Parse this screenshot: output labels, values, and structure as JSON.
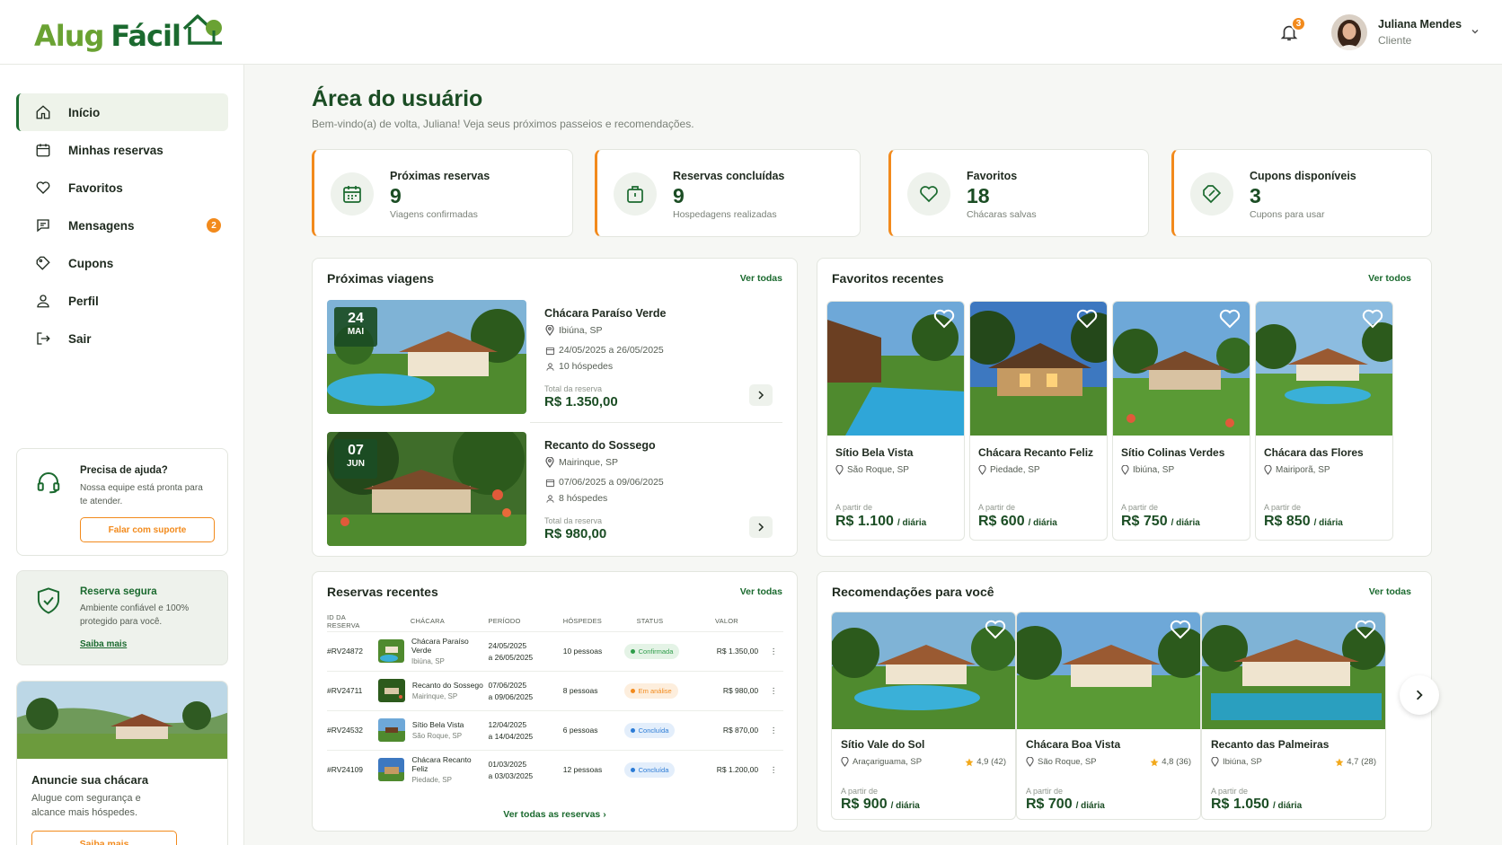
{
  "brand": {
    "part1": "Alug",
    "part2": "Fácil"
  },
  "header": {
    "notifications_count": "3",
    "user_name": "Juliana Mendes",
    "user_role": "Cliente"
  },
  "sidebar": {
    "items": [
      {
        "label": "Início",
        "icon": "home-icon"
      },
      {
        "label": "Minhas reservas",
        "icon": "calendar-icon"
      },
      {
        "label": "Favoritos",
        "icon": "heart-icon"
      },
      {
        "label": "Mensagens",
        "icon": "chat-icon",
        "badge": "2"
      },
      {
        "label": "Cupons",
        "icon": "ticket-icon"
      },
      {
        "label": "Perfil",
        "icon": "user-icon"
      },
      {
        "label": "Sair",
        "icon": "logout-icon"
      }
    ],
    "help": {
      "title": "Precisa de ajuda?",
      "text": "Nossa equipe está pronta para te atender.",
      "button": "Falar com suporte"
    },
    "secure": {
      "title": "Reserva segura",
      "text": "Ambiente confiável e 100% protegido para você.",
      "link": "Saiba mais"
    },
    "promo": {
      "title": "Anuncie sua chácara",
      "text": "Alugue com segurança e alcance mais hóspedes.",
      "button": "Saiba mais"
    }
  },
  "main": {
    "title": "Área do usuário",
    "subtitle": "Bem-vindo(a) de volta, Juliana! Veja seus próximos passeios e recomendações."
  },
  "stats": [
    {
      "label": "Próximas reservas",
      "value": "9",
      "sub": "Viagens confirmadas",
      "icon": "calendar-icon"
    },
    {
      "label": "Reservas concluídas",
      "value": "9",
      "sub": "Hospedagens realizadas",
      "icon": "luggage-icon"
    },
    {
      "label": "Favoritos",
      "value": "18",
      "sub": "Chácaras salvas",
      "icon": "heart-icon"
    },
    {
      "label": "Cupons disponíveis",
      "value": "3",
      "sub": "Cupons para usar",
      "icon": "coupon-icon"
    }
  ],
  "upcoming": {
    "title": "Próximas viagens",
    "link": "Ver todas",
    "trips": [
      {
        "day": "24",
        "month": "MAI",
        "name": "Chácara Paraíso Verde",
        "location": "Ibiúna, SP",
        "dates": "24/05/2025 a 26/05/2025",
        "guests": "10 hóspedes",
        "total_label": "Total da reserva",
        "price": "R$ 1.350,00"
      },
      {
        "day": "07",
        "month": "JUN",
        "name": "Recanto do Sossego",
        "location": "Mairinque, SP",
        "dates": "07/06/2025 a 09/06/2025",
        "guests": "8 hóspedes",
        "total_label": "Total da reserva",
        "price": "R$ 980,00"
      }
    ]
  },
  "favorites": {
    "title": "Favoritos recentes",
    "link": "Ver todos",
    "items": [
      {
        "name": "Sítio Bela Vista",
        "location": "São Roque, SP",
        "from": "A partir de",
        "price": "R$ 1.100",
        "unit": "/ diária"
      },
      {
        "name": "Chácara Recanto Feliz",
        "location": "Piedade, SP",
        "from": "A partir de",
        "price": "R$ 600",
        "unit": "/ diária"
      },
      {
        "name": "Sítio Colinas Verdes",
        "location": "Ibiúna, SP",
        "from": "A partir de",
        "price": "R$ 750",
        "unit": "/ diária"
      },
      {
        "name": "Chácara das Flores",
        "location": "Mairiporã, SP",
        "from": "A partir de",
        "price": "R$ 850",
        "unit": "/ diária"
      }
    ]
  },
  "reservations": {
    "title": "Reservas recentes",
    "link": "Ver todas",
    "footer_link": "Ver todas as reservas",
    "columns": [
      "ID DA RESERVA",
      "CHÁCARA",
      "PERÍODO",
      "HÓSPEDES",
      "STATUS",
      "VALOR"
    ],
    "rows": [
      {
        "id": "#RV24872",
        "name": "Chácara Paraíso Verde",
        "location": "Ibiúna, SP",
        "from": "24/05/2025",
        "to": "a 26/05/2025",
        "guests": "10 pessoas",
        "status": "Confirmada",
        "value": "R$ 1.350,00"
      },
      {
        "id": "#RV24711",
        "name": "Recanto do Sossego",
        "location": "Mairinque, SP",
        "from": "07/06/2025",
        "to": "a 09/06/2025",
        "guests": "8 pessoas",
        "status": "Em análise",
        "value": "R$ 980,00"
      },
      {
        "id": "#RV24532",
        "name": "Sítio Bela Vista",
        "location": "São Roque, SP",
        "from": "12/04/2025",
        "to": "a 14/04/2025",
        "guests": "6 pessoas",
        "status": "Concluída",
        "value": "R$ 870,00"
      },
      {
        "id": "#RV24109",
        "name": "Chácara Recanto Feliz",
        "location": "Piedade, SP",
        "from": "01/03/2025",
        "to": "a 03/03/2025",
        "guests": "12 pessoas",
        "status": "Concluída",
        "value": "R$ 1.200,00"
      }
    ]
  },
  "recommendations": {
    "title": "Recomendações para você",
    "link": "Ver todas",
    "items": [
      {
        "name": "Sítio Vale do Sol",
        "location": "Araçariguama, SP",
        "rating": "4,9 (42)",
        "from": "A partir de",
        "price": "R$ 900",
        "unit": "/ diária"
      },
      {
        "name": "Chácara Boa Vista",
        "location": "São Roque, SP",
        "rating": "4,8 (36)",
        "from": "A partir de",
        "price": "R$ 700",
        "unit": "/ diária"
      },
      {
        "name": "Recanto das Palmeiras",
        "location": "Ibiúna, SP",
        "rating": "4,7 (28)",
        "from": "A partir de",
        "price": "R$ 1.050",
        "unit": "/ diária"
      }
    ]
  },
  "colors": {
    "primary": "#1b6a2f",
    "dark": "#1b4d24",
    "accent": "#f28a1c",
    "confirmed": "#2e9d4a",
    "pending": "#f28a1c",
    "done": "#2b7bd6"
  }
}
